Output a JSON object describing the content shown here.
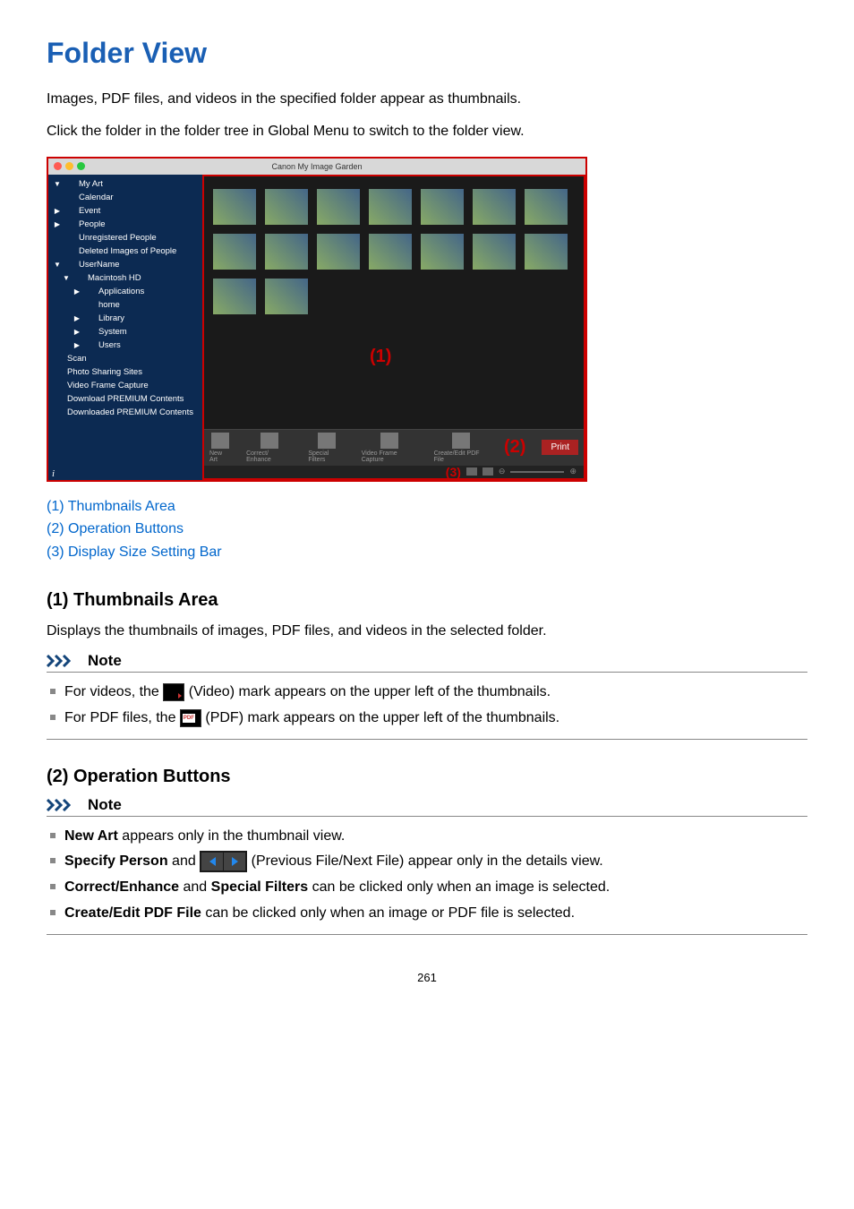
{
  "title": "Folder View",
  "intro": [
    "Images, PDF files, and videos in the specified folder appear as thumbnails.",
    "Click the folder in the folder tree in Global Menu to switch to the folder view."
  ],
  "screenshot": {
    "titlebar": "Canon My Image Garden",
    "sidebar": [
      {
        "label": "My Art",
        "caret": "▼",
        "indent": 0
      },
      {
        "label": "Calendar",
        "indent": 0,
        "sp": true
      },
      {
        "label": "Event",
        "caret": "▶",
        "indent": 0
      },
      {
        "label": "People",
        "caret": "▶",
        "indent": 0
      },
      {
        "label": "Unregistered People",
        "indent": 0,
        "sp": true
      },
      {
        "label": "Deleted Images of People",
        "indent": 0,
        "sp": true
      },
      {
        "label": "UserName",
        "caret": "▼",
        "indent": 0
      },
      {
        "label": "Macintosh HD",
        "caret": "▼",
        "indent": 1
      },
      {
        "label": "Applications",
        "caret": "▶",
        "indent": 2
      },
      {
        "label": "home",
        "indent": 2,
        "sp": true
      },
      {
        "label": "Library",
        "caret": "▶",
        "indent": 2
      },
      {
        "label": "System",
        "caret": "▶",
        "indent": 2
      },
      {
        "label": "Users",
        "caret": "▶",
        "indent": 2
      },
      {
        "label": "Scan",
        "indent": 0
      },
      {
        "label": "Photo Sharing Sites",
        "indent": 0
      },
      {
        "label": "Video Frame Capture",
        "indent": 0
      },
      {
        "label": "Download PREMIUM Contents",
        "indent": 0
      },
      {
        "label": "Downloaded PREMIUM Contents",
        "indent": 0
      }
    ],
    "markers": {
      "m1": "(1)",
      "m2": "(2)",
      "m3": "(3)"
    },
    "op_buttons": [
      "New Art",
      "Correct/\nEnhance",
      "Special\nFilters",
      "Video Frame\nCapture",
      "Create/Edit\nPDF File"
    ],
    "print_label": "Print"
  },
  "quick_links": [
    "(1) Thumbnails Area",
    "(2) Operation Buttons",
    "(3) Display Size Setting Bar"
  ],
  "section1": {
    "heading": "(1) Thumbnails Area",
    "desc": "Displays the thumbnails of images, PDF files, and videos in the selected folder.",
    "note_label": "Note",
    "notes": {
      "video_pre": "For videos, the ",
      "video_post": " (Video) mark appears on the upper left of the thumbnails.",
      "pdf_pre": "For PDF files, the ",
      "pdf_post": " (PDF) mark appears on the upper left of the thumbnails."
    }
  },
  "section2": {
    "heading": "(2) Operation Buttons",
    "note_label": "Note",
    "items": {
      "i1_b": "New Art",
      "i1_t": " appears only in the thumbnail view.",
      "i2_b1": "Specify Person",
      "i2_mid": " and ",
      "i2_t": " (Previous File/Next File) appear only in the details view.",
      "i3_b1": "Correct/Enhance",
      "i3_mid": " and ",
      "i3_b2": "Special Filters",
      "i3_t": " can be clicked only when an image is selected.",
      "i4_b": "Create/Edit PDF File",
      "i4_t": " can be clicked only when an image or PDF file is selected."
    }
  },
  "page_number": "261"
}
